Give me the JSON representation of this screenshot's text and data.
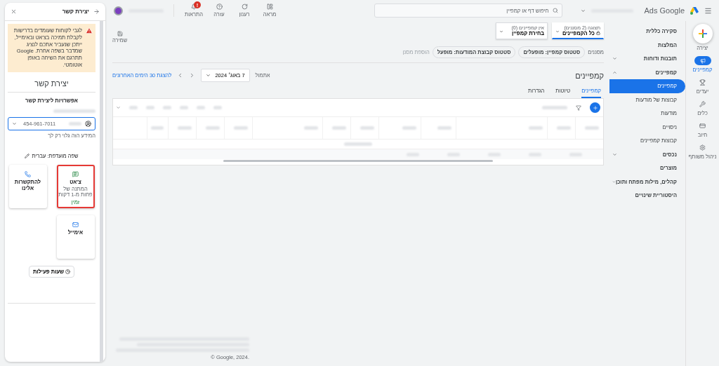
{
  "contact_panel": {
    "title": "יצירת קשר",
    "warning": "לגבי לקוחות שעומדים בדרישות לקבלת תמיכה בצ'אט ובאימייל, ייתכן שנעביר אתכם לנציג שמדבר בשפה אחרת. Google תתרגם את השיחה באופן אוטומטי.",
    "heading": "יצירת קשר",
    "subheading": "אפשרויות ליצירת קשר",
    "phone": {
      "value": "454-961-7011"
    },
    "phone_hint": "המידע הזה גלוי רק לך",
    "language": "שפה מועדפת: עברית",
    "options": [
      {
        "kind": "chat",
        "title": "צ'אט",
        "detail": "המתנה של פחות מ-1 דקות",
        "status": "זמין",
        "selected": true
      },
      {
        "kind": "phone",
        "title": "להתקשרות אלינו",
        "selected": false
      },
      {
        "kind": "email",
        "title": "אימייל",
        "selected": false
      }
    ],
    "hours_button": "שעות פעילות"
  },
  "top_bar": {
    "logo": "Ads Google",
    "search_placeholder": "חיפוש דף או קמפיין",
    "actions": [
      {
        "kind": "appearance",
        "label": "מראה"
      },
      {
        "kind": "refresh",
        "label": "רענון"
      },
      {
        "kind": "help",
        "label": "עזרה"
      },
      {
        "kind": "notifications",
        "label": "התראות",
        "badge": "!"
      }
    ]
  },
  "view_filters": [
    {
      "caption": "תצוגה (2 מסננים)",
      "value": "כל הקמפיינים",
      "selected": true
    },
    {
      "caption": "אין קמפיינים (0)",
      "value": "בחירת קמפיין",
      "selected": false
    }
  ],
  "save": "שמירה",
  "filters": {
    "label": "מסננים",
    "chips": [
      "סטטוס קמפיין: מופעלים",
      "סטטוס קבוצת המודעות: מופעל"
    ],
    "add": "הוספת מסנן"
  },
  "page_title": "קמפיינים",
  "date": {
    "preset": "אתמול",
    "value": "7 באוג׳ 2024",
    "shortcut": "להצגת 30 הימים האחרונים"
  },
  "tabs": [
    {
      "label": "קמפיינים",
      "selected": true
    },
    {
      "label": "טיוטות",
      "selected": false
    },
    {
      "label": "הגדרות",
      "selected": false
    }
  ],
  "nav": [
    {
      "label": "סקירה כללית",
      "selected": false
    },
    {
      "label": "המלצות",
      "selected": false
    },
    {
      "label": "תובנות ודוחות",
      "selected": false,
      "expanded": false
    },
    {
      "label": "קמפיינים",
      "selected": false,
      "expanded": true,
      "children": [
        {
          "label": "קמפיינים",
          "selected": true
        },
        {
          "label": "קבוצות של מודעות",
          "selected": false
        },
        {
          "label": "מודעות",
          "selected": false
        },
        {
          "label": "ניסויים",
          "selected": false
        },
        {
          "label": "קבוצות קמפיינים",
          "selected": false
        }
      ]
    },
    {
      "label": "נכסים",
      "selected": false,
      "expanded": false
    },
    {
      "label": "מוצרים",
      "selected": false
    },
    {
      "label": "קהלים, מילות מפתח ותוכן",
      "selected": false,
      "expanded": false
    },
    {
      "label": "היסטוריית שינויים",
      "selected": false
    }
  ],
  "rail": [
    {
      "kind": "create",
      "label": "יצירה",
      "selected": false
    },
    {
      "kind": "campaigns",
      "label": "קמפיינים",
      "selected": true
    },
    {
      "kind": "goals",
      "label": "יעדים",
      "selected": false
    },
    {
      "kind": "tools",
      "label": "כלים",
      "selected": false
    },
    {
      "kind": "billing",
      "label": "חיוב",
      "selected": false
    },
    {
      "kind": "admin",
      "label": "ניהול משותף",
      "selected": false
    }
  ],
  "footer": {
    "copyright": "© Google, 2024."
  }
}
